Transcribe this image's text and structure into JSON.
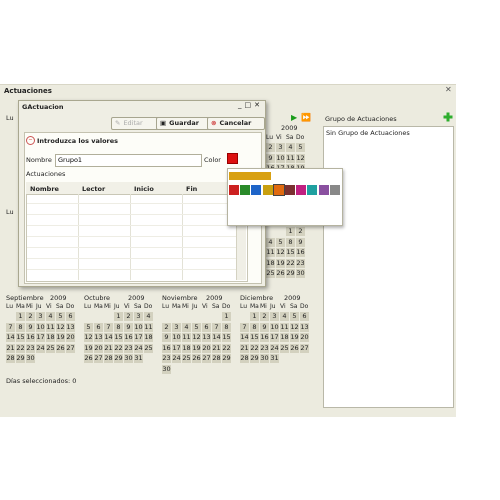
{
  "outer": {
    "title": "Actuaciones",
    "close": "✕"
  },
  "group_panel": {
    "label": "Grupo de Actuaciones",
    "items": [
      "Sin Grupo de Actuaciones"
    ]
  },
  "dialog": {
    "title": "GActuacion",
    "buttons": {
      "edit": "Editar",
      "save": "Guardar",
      "cancel": "Cancelar"
    },
    "section_title": "Introduzca los valores",
    "name_label": "Nombre",
    "name_value": "Grupo1",
    "color_label": "Color",
    "color_value": "#dd1111",
    "actuaciones_label": "Actuaciones",
    "columns": [
      "Nombre",
      "Lector",
      "Inicio",
      "Fin"
    ]
  },
  "picker_colors": [
    "#cc2020",
    "#2a8a2a",
    "#1e64c8",
    "#c9a010",
    "#e06a10",
    "#7a3030",
    "#c02080",
    "#20a0a0",
    "#8a50a0",
    "#888888"
  ],
  "picker_selected": "#d8a012",
  "side": {
    "year": "2009",
    "weekdays": [
      "Lu",
      "Vi",
      "Sa",
      "Do"
    ],
    "days1": [
      "2",
      "3",
      "4",
      "5",
      "9",
      "10",
      "11",
      "12",
      "16",
      "17",
      "18",
      "19",
      "23",
      "24",
      "25",
      "26",
      "30",
      "31",
      "",
      ""
    ],
    "days2": [
      "",
      "",
      "1",
      "2",
      "4",
      "5",
      "8",
      "9",
      "11",
      "12",
      "15",
      "16",
      "18",
      "19",
      "22",
      "23",
      "25",
      "26",
      "29",
      "30"
    ]
  },
  "left_frag": {
    "a": "Lu",
    "b": "Lu"
  },
  "calendars": [
    {
      "month": "Septiembre",
      "year": "2009",
      "weekdays": [
        "Lu",
        "Ma",
        "Mi",
        "Ju",
        "Vi",
        "Sa",
        "Do"
      ],
      "days": [
        "",
        "1",
        "2",
        "3",
        "4",
        "5",
        "6",
        "7",
        "8",
        "9",
        "10",
        "11",
        "12",
        "13",
        "14",
        "15",
        "16",
        "17",
        "18",
        "19",
        "20",
        "21",
        "22",
        "23",
        "24",
        "25",
        "26",
        "27",
        "28",
        "29",
        "30",
        "",
        "",
        "",
        ""
      ]
    },
    {
      "month": "Octubre",
      "year": "2009",
      "weekdays": [
        "Lu",
        "Ma",
        "Mi",
        "Ju",
        "Vi",
        "Sa",
        "Do"
      ],
      "days": [
        "",
        "",
        "",
        "1",
        "2",
        "3",
        "4",
        "5",
        "6",
        "7",
        "8",
        "9",
        "10",
        "11",
        "12",
        "13",
        "14",
        "15",
        "16",
        "17",
        "18",
        "19",
        "20",
        "21",
        "22",
        "23",
        "24",
        "25",
        "26",
        "27",
        "28",
        "29",
        "30",
        "31",
        ""
      ]
    },
    {
      "month": "Noviembre",
      "year": "2009",
      "weekdays": [
        "Lu",
        "Ma",
        "Mi",
        "Ju",
        "Vi",
        "Sa",
        "Do"
      ],
      "days": [
        "",
        "",
        "",
        "",
        "",
        "",
        "1",
        "2",
        "3",
        "4",
        "5",
        "6",
        "7",
        "8",
        "9",
        "10",
        "11",
        "12",
        "13",
        "14",
        "15",
        "16",
        "17",
        "18",
        "19",
        "20",
        "21",
        "22",
        "23",
        "24",
        "25",
        "26",
        "27",
        "28",
        "29",
        "30",
        "",
        "",
        "",
        "",
        "",
        ""
      ]
    },
    {
      "month": "Diciembre",
      "year": "2009",
      "weekdays": [
        "Lu",
        "Ma",
        "Mi",
        "Ju",
        "Vi",
        "Sa",
        "Do"
      ],
      "days": [
        "",
        "1",
        "2",
        "3",
        "4",
        "5",
        "6",
        "7",
        "8",
        "9",
        "10",
        "11",
        "12",
        "13",
        "14",
        "15",
        "16",
        "17",
        "18",
        "19",
        "20",
        "21",
        "22",
        "23",
        "24",
        "25",
        "26",
        "27",
        "28",
        "29",
        "30",
        "31",
        "",
        "",
        ""
      ]
    }
  ],
  "footer": {
    "selected_days": "Días seleccionados: 0"
  }
}
